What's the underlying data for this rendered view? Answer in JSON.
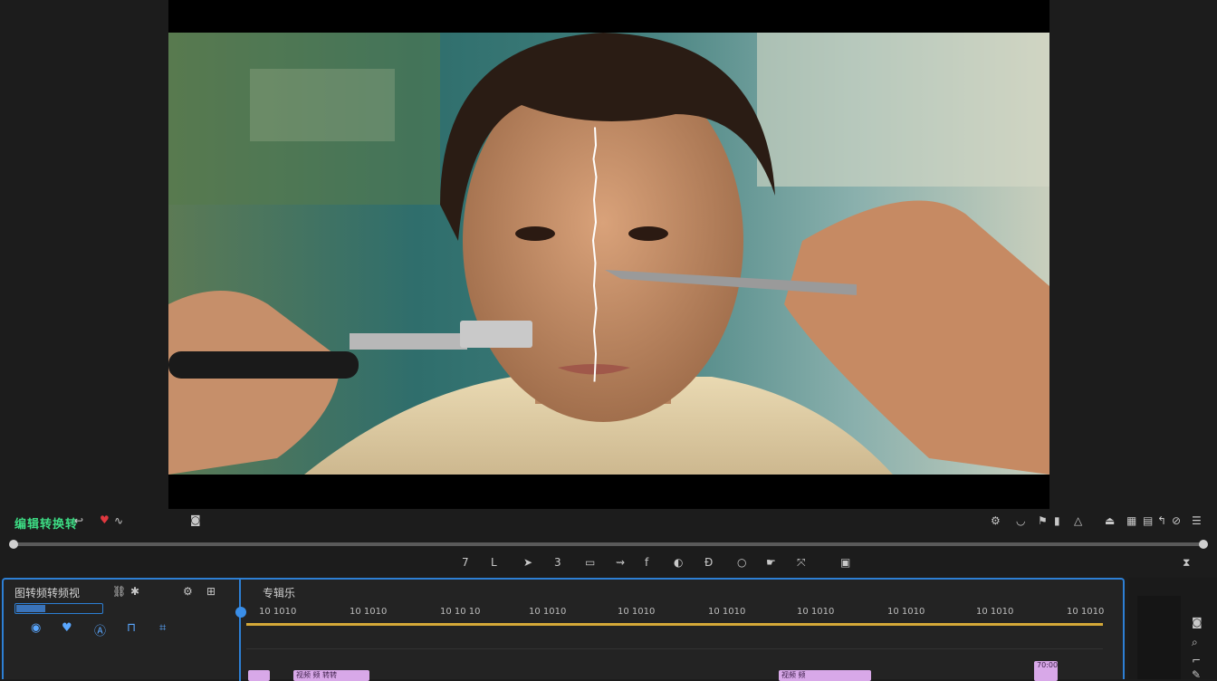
{
  "monitor": {
    "title": "编辑转换转",
    "left_icons": [
      "undo-icon",
      "marker-heart-icon",
      "wave-icon",
      "camera-icon"
    ],
    "right_icons": [
      "settings-icon",
      "shield-icon",
      "flag-icon",
      "clip-icon",
      "triangle-icon",
      "export-icon",
      "grid-icon",
      "photo-icon",
      "arrow-icon",
      "check-circle-icon",
      "menu-icon"
    ]
  },
  "transport": {
    "buttons": [
      "7",
      "L",
      "➤",
      "3",
      "▭",
      "⇝",
      "f",
      "◐",
      "Ɖ",
      "○",
      "☛",
      "⤧",
      "▣",
      "⧗"
    ]
  },
  "timeline": {
    "sequence_name": "图转频转频视",
    "sequence_icons": [
      "link-icon",
      "sparkle-icon"
    ],
    "track_label": "专辑乐",
    "ruler_labels": [
      "10 1010",
      "10 1010",
      "10 10 10",
      "10 1010",
      "10 1010",
      "10 1010",
      "10 1010",
      "10 1010",
      "10 1010",
      "10 1010"
    ],
    "clips": [
      "",
      "视频 频 转转",
      "",
      "视频 频"
    ],
    "clip_badge": "70:00"
  },
  "colors": {
    "accent": "#2d7fd4",
    "title_green": "#3ddc84",
    "clip": "#d8a8e8",
    "work_area": "#d4a838"
  }
}
